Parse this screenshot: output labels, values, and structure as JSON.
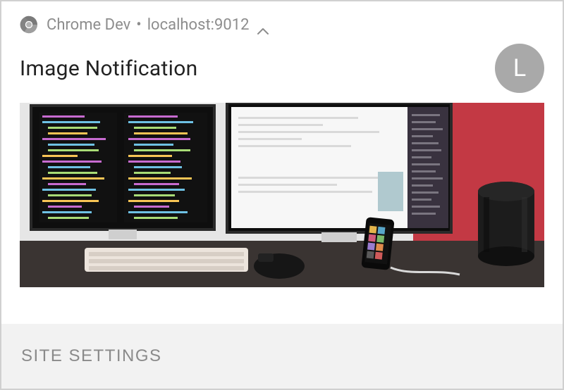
{
  "header": {
    "app_name": "Chrome Dev",
    "origin": "localhost:9012"
  },
  "notification": {
    "title": "Image Notification",
    "avatar_letter": "L"
  },
  "actions": {
    "site_settings": "SITE SETTINGS"
  }
}
